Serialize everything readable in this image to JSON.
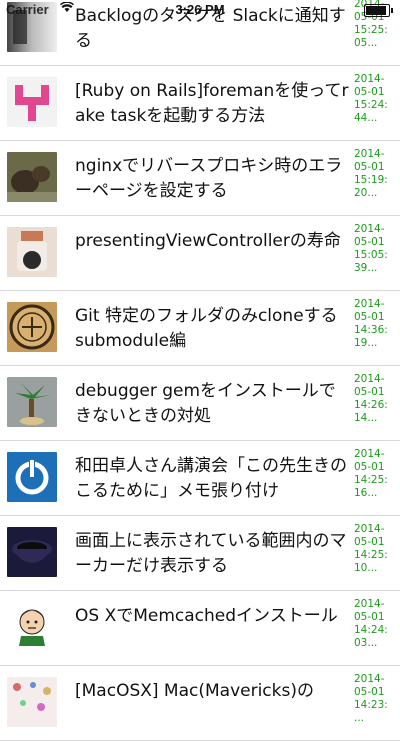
{
  "status_bar": {
    "carrier": "Carrier",
    "time": "3:26 PM"
  },
  "feed": {
    "items": [
      {
        "title": "Backlogのタスクを Slackに通知する",
        "date": [
          "2014-",
          "05-01",
          "15:25:",
          "05..."
        ],
        "thumb": "blurry-gray-photo"
      },
      {
        "title": "[Ruby on Rails]foremanを使ってrake taskを起動する方法",
        "date": [
          "2014-",
          "05-01",
          "15:24:",
          "44..."
        ],
        "thumb": "pink-pixel-icon"
      },
      {
        "title": "nginxでリバースプロキシ時のエラーページを設定する",
        "date": [
          "2014-",
          "05-01",
          "15:19:",
          "20..."
        ],
        "thumb": "animal-photo"
      },
      {
        "title": "presentingViewControllerの寿命",
        "date": [
          "2014-",
          "05-01",
          "15:05:",
          "39..."
        ],
        "thumb": "jar-photo"
      },
      {
        "title": "Git 特定のフォルダのみcloneする submodule編",
        "date": [
          "2014-",
          "05-01",
          "14:36:",
          "19..."
        ],
        "thumb": "seal-emblem"
      },
      {
        "title": "debugger gemをインストールできないときの対処",
        "date": [
          "2014-",
          "05-01",
          "14:26:",
          "14..."
        ],
        "thumb": "palm-tree-figure"
      },
      {
        "title": "和田卓人さん講演会「この先生きのこるために」メモ張り付け",
        "date": [
          "2014-",
          "05-01",
          "14:25:",
          "16..."
        ],
        "thumb": "power-logo"
      },
      {
        "title": "画面上に表示されている範囲内のマーカーだけ表示する",
        "date": [
          "2014-",
          "05-01",
          "14:25:",
          "10..."
        ],
        "thumb": "coffee-cup-photo"
      },
      {
        "title": "OS XでMemcachedインストール",
        "date": [
          "2014-",
          "05-01",
          "14:24:",
          "03..."
        ],
        "thumb": "cartoon-avatar"
      },
      {
        "title": "[MacOSX] Mac(Mavericks)の",
        "date": [
          "2014-",
          "05-01",
          "14:23:",
          "..."
        ],
        "thumb": "pattern-thumb"
      }
    ]
  },
  "colors": {
    "date_text": "#1c9b1c",
    "separator": "#d8d8d8",
    "title_text": "#111111"
  }
}
